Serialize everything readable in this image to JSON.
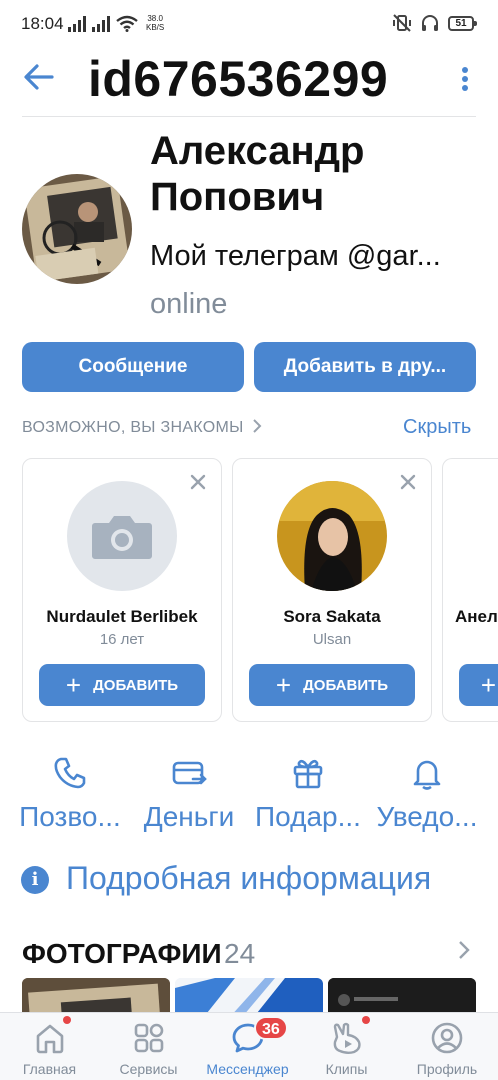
{
  "status_bar": {
    "time": "18:04",
    "net_speed_value": "38.0",
    "net_speed_unit": "KB/S",
    "battery": "51"
  },
  "header": {
    "title": "id676536299",
    "back_icon": "arrow-left-icon",
    "menu_icon": "more-vertical-icon"
  },
  "profile": {
    "name": "Александр Попович",
    "status": "Мой телеграм @gar...",
    "online": "online",
    "message_button": "Сообщение",
    "add_friend_button": "Добавить в дру..."
  },
  "suggestions": {
    "title": "ВОЗМОЖНО, ВЫ ЗНАКОМЫ",
    "hide": "Скрыть",
    "cards": [
      {
        "name": "Nurdaulet Berlibek",
        "subtitle": "16 лет",
        "add": "ДОБАВИТЬ"
      },
      {
        "name": "Sora Sakata",
        "subtitle": "Ulsan",
        "add": "ДОБАВИТЬ"
      },
      {
        "name": "Анелъ"
      }
    ]
  },
  "actions": [
    {
      "label": "Позво...",
      "icon": "phone-icon"
    },
    {
      "label": "Деньги",
      "icon": "money-card-icon"
    },
    {
      "label": "Подар...",
      "icon": "gift-icon"
    },
    {
      "label": "Уведо...",
      "icon": "bell-icon"
    }
  ],
  "details": {
    "label": "Подробная информация",
    "icon": "info-icon",
    "icon_glyph": "i"
  },
  "photos": {
    "title": "ФОТОГРАФИИ",
    "count": "24"
  },
  "tabbar": {
    "tabs": [
      {
        "label": "Главная",
        "icon": "home-icon"
      },
      {
        "label": "Сервисы",
        "icon": "services-grid-icon"
      },
      {
        "label": "Мессенджер",
        "icon": "messenger-icon",
        "badge": "36"
      },
      {
        "label": "Клипы",
        "icon": "clips-icon"
      },
      {
        "label": "Профиль",
        "icon": "profile-icon"
      }
    ]
  },
  "colors": {
    "accent": "#4a86d0",
    "secondary_text": "#818c99",
    "badge": "#e64646"
  }
}
